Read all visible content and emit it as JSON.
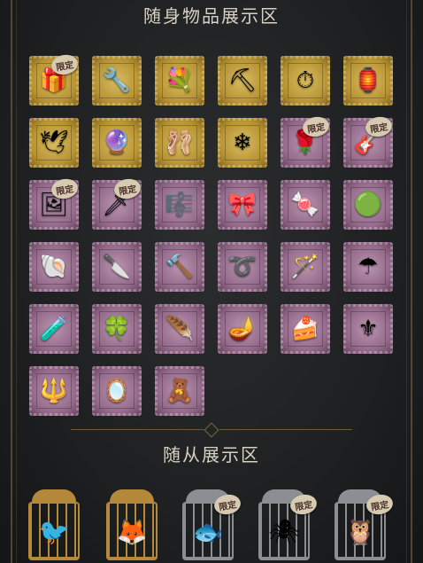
{
  "sections": {
    "items_title": "随身物品展示区",
    "pets_title": "随从展示区"
  },
  "badge_text": "限定",
  "colors": {
    "gold": "#c9a94a",
    "purple": "#946a8a",
    "frame": "#6b5a3a",
    "title": "#d8d2c4"
  },
  "items": [
    {
      "icon": "gift-box-icon",
      "glyph": "🎁",
      "stamp": "gold",
      "limited": true
    },
    {
      "icon": "wrench-rose-icon",
      "glyph": "🔧",
      "stamp": "gold",
      "limited": false
    },
    {
      "icon": "flower-bouquet-icon",
      "glyph": "💐",
      "stamp": "gold",
      "limited": false
    },
    {
      "icon": "scythe-icon",
      "glyph": "⛏",
      "stamp": "gold",
      "limited": false
    },
    {
      "icon": "pocket-watch-icon",
      "glyph": "⏱",
      "stamp": "gold",
      "limited": false
    },
    {
      "icon": "lantern-icon",
      "glyph": "🏮",
      "stamp": "gold",
      "limited": false
    },
    {
      "icon": "blue-bird-icon",
      "glyph": "🕊",
      "stamp": "gold",
      "limited": false
    },
    {
      "icon": "crystal-wand-icon",
      "glyph": "🔮",
      "stamp": "gold",
      "limited": false
    },
    {
      "icon": "ballerina-icon",
      "glyph": "🩰",
      "stamp": "gold",
      "limited": false
    },
    {
      "icon": "ice-crystal-icon",
      "glyph": "❄",
      "stamp": "gold",
      "limited": false
    },
    {
      "icon": "rose-wand-icon",
      "glyph": "🌹",
      "stamp": "purple",
      "limited": true
    },
    {
      "icon": "guitar-icon",
      "glyph": "🎸",
      "stamp": "purple",
      "limited": true
    },
    {
      "icon": "picture-frame-icon",
      "glyph": "🖼",
      "stamp": "purple",
      "limited": true
    },
    {
      "icon": "golden-sword-icon",
      "glyph": "🗡",
      "stamp": "purple",
      "limited": true
    },
    {
      "icon": "music-box-icon",
      "glyph": "🎼",
      "stamp": "purple",
      "limited": false
    },
    {
      "icon": "white-bow-icon",
      "glyph": "🎀",
      "stamp": "purple",
      "limited": false
    },
    {
      "icon": "candy-icon",
      "glyph": "🍬",
      "stamp": "purple",
      "limited": false
    },
    {
      "icon": "green-orb-icon",
      "glyph": "🟢",
      "stamp": "purple",
      "limited": false
    },
    {
      "icon": "seashell-icon",
      "glyph": "🐚",
      "stamp": "purple",
      "limited": false
    },
    {
      "icon": "dark-blade-icon",
      "glyph": "🔪",
      "stamp": "purple",
      "limited": false
    },
    {
      "icon": "hammer-icon",
      "glyph": "🔨",
      "stamp": "purple",
      "limited": false
    },
    {
      "icon": "whip-icon",
      "glyph": "➰",
      "stamp": "purple",
      "limited": false
    },
    {
      "icon": "scepter-icon",
      "glyph": "🪄",
      "stamp": "purple",
      "limited": false
    },
    {
      "icon": "umbrella-icon",
      "glyph": "☂",
      "stamp": "purple",
      "limited": false
    },
    {
      "icon": "potion-bottle-icon",
      "glyph": "🧪",
      "stamp": "purple",
      "limited": false
    },
    {
      "icon": "clover-amulet-icon",
      "glyph": "🍀",
      "stamp": "purple",
      "limited": false
    },
    {
      "icon": "feather-quill-icon",
      "glyph": "🪶",
      "stamp": "purple",
      "limited": false
    },
    {
      "icon": "magic-lamp-icon",
      "glyph": "🪔",
      "stamp": "purple",
      "limited": false
    },
    {
      "icon": "cake-icon",
      "glyph": "🍰",
      "stamp": "purple",
      "limited": false
    },
    {
      "icon": "ornate-staff-icon",
      "glyph": "⚜",
      "stamp": "purple",
      "limited": false
    },
    {
      "icon": "trident-icon",
      "glyph": "🔱",
      "stamp": "purple",
      "limited": false
    },
    {
      "icon": "hand-mirror-icon",
      "glyph": "🪞",
      "stamp": "purple",
      "limited": false
    },
    {
      "icon": "doll-icon",
      "glyph": "🧸",
      "stamp": "purple",
      "limited": false
    }
  ],
  "pets": [
    {
      "icon": "crow-pet-icon",
      "glyph": "🐦",
      "cage": "gold",
      "limited": false
    },
    {
      "icon": "white-fox-pet-icon",
      "glyph": "🦊",
      "cage": "gold",
      "limited": false
    },
    {
      "icon": "fish-pet-icon",
      "glyph": "🐟",
      "cage": "silver",
      "limited": true
    },
    {
      "icon": "spider-pet-icon",
      "glyph": "🕷",
      "cage": "silver",
      "limited": true
    },
    {
      "icon": "owl-pet-icon",
      "glyph": "🦉",
      "cage": "silver",
      "limited": true
    }
  ]
}
